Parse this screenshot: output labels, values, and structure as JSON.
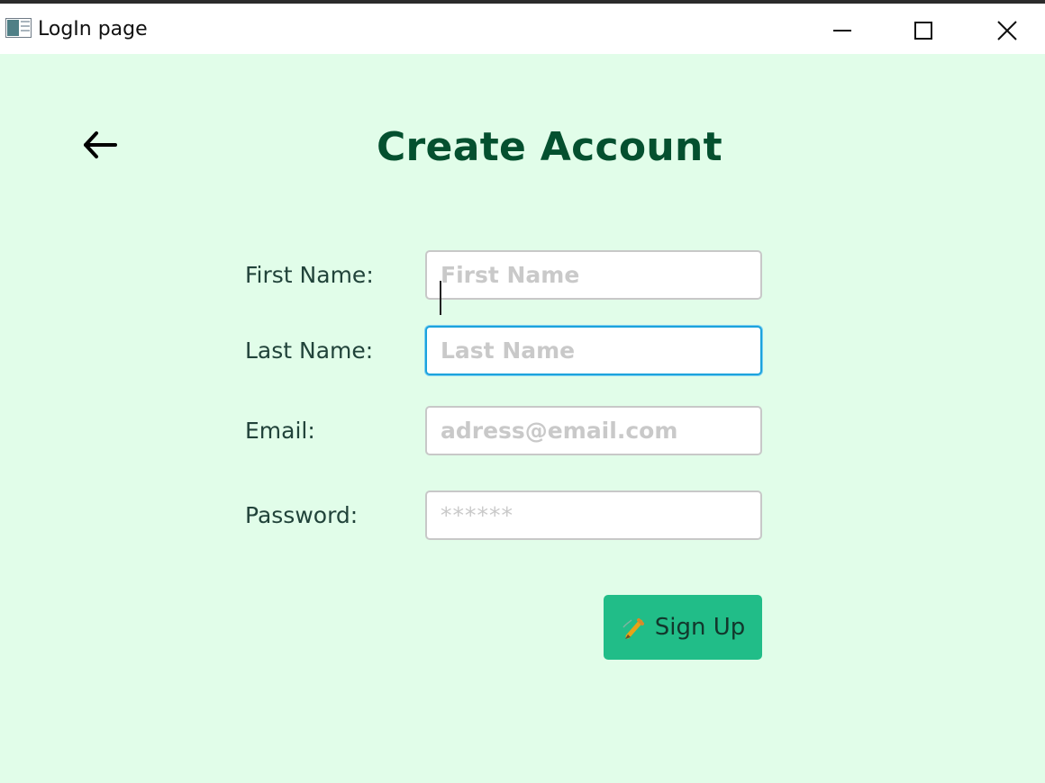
{
  "window": {
    "title": "LogIn page",
    "controls": [
      "minimize",
      "maximize",
      "close"
    ]
  },
  "page": {
    "title": "Create Account",
    "back_icon": "arrow-left-icon"
  },
  "form": {
    "fields": [
      {
        "label": "First Name:",
        "placeholder": "First Name",
        "value": "",
        "focused": false
      },
      {
        "label": "Last Name:",
        "placeholder": "Last Name",
        "value": "",
        "focused": true
      },
      {
        "label": "Email:",
        "placeholder": "adress@email.com",
        "value": ""
      },
      {
        "label": "Password:",
        "placeholder": "******",
        "value": ""
      }
    ],
    "submit": {
      "label": "Sign Up",
      "icon": "pencil-icon"
    }
  },
  "colors": {
    "background": "#e1fde9",
    "title": "#04502f",
    "label": "#21433a",
    "button": "#21bd88",
    "focus_border": "#1ca3dc"
  }
}
